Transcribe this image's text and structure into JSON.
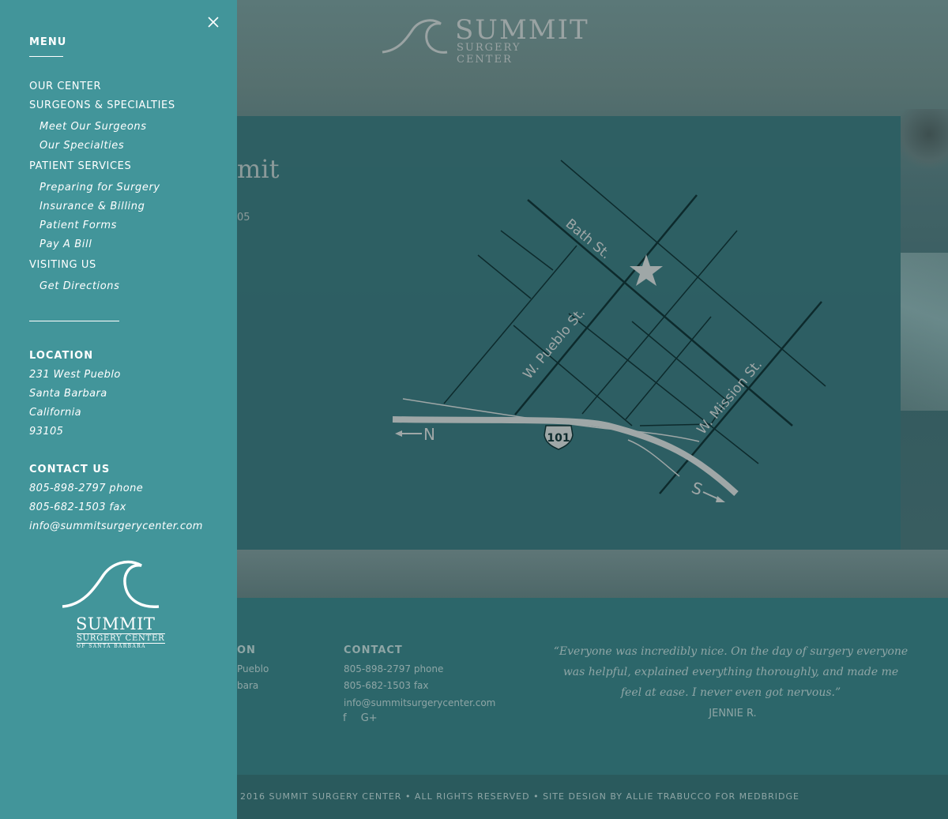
{
  "brand": {
    "name": "SUMMIT",
    "tagline": "SURGERY CENTER",
    "locale": "OF SANTA BARBARA"
  },
  "menu": {
    "heading": "MENU",
    "items": [
      {
        "label": "OUR CENTER"
      },
      {
        "label": "SURGEONS & SPECIALTIES",
        "children": [
          "Meet Our Surgeons",
          "Our Specialties"
        ]
      },
      {
        "label": "PATIENT SERVICES",
        "children": [
          "Preparing for Surgery",
          "Insurance & Billing",
          "Patient Forms",
          "Pay A Bill"
        ]
      },
      {
        "label": "VISITING US",
        "children": [
          "Get Directions"
        ]
      }
    ],
    "location": {
      "heading": "LOCATION",
      "lines": [
        "231 West Pueblo",
        "Santa Barbara",
        "California",
        "93105"
      ]
    },
    "contact": {
      "heading": "CONTACT US",
      "lines": [
        "805-898-2797 phone",
        "805-682-1503 fax",
        "info@summitsurgerycenter.com"
      ]
    }
  },
  "page": {
    "title_fragment": "mit",
    "zip_fragment": "05",
    "map": {
      "streets": [
        "Bath St.",
        "W. Pueblo St.",
        "W. Mission St."
      ],
      "highway": "101",
      "compass_north": "N",
      "compass_south": "S"
    },
    "footer": {
      "location_heading_fragment": "ON",
      "location_lines": [
        "Pueblo",
        "bara"
      ],
      "contact_heading": "CONTACT",
      "contact_lines": [
        "805-898-2797 phone",
        "805-682-1503 fax",
        "info@summitsurgerycenter.com"
      ],
      "social": [
        "f",
        "G+"
      ],
      "quote": "“Everyone was incredibly nice. On the day of surgery everyone was helpful, explained everything thoroughly, and made me feel at ease. I never even got nervous.”",
      "quote_author": "JENNIE R."
    },
    "copyright": "2016 SUMMIT SURGERY CENTER • ALL RIGHTS RESERVED • SITE DESIGN BY ALLIE TRABUCCO FOR MEDBRIDGE"
  },
  "colors": {
    "menu_bg": "#42959a",
    "footer_bg": "#2c666a",
    "map_card": "#2d5f63",
    "text_on_menu": "#ffffff"
  }
}
